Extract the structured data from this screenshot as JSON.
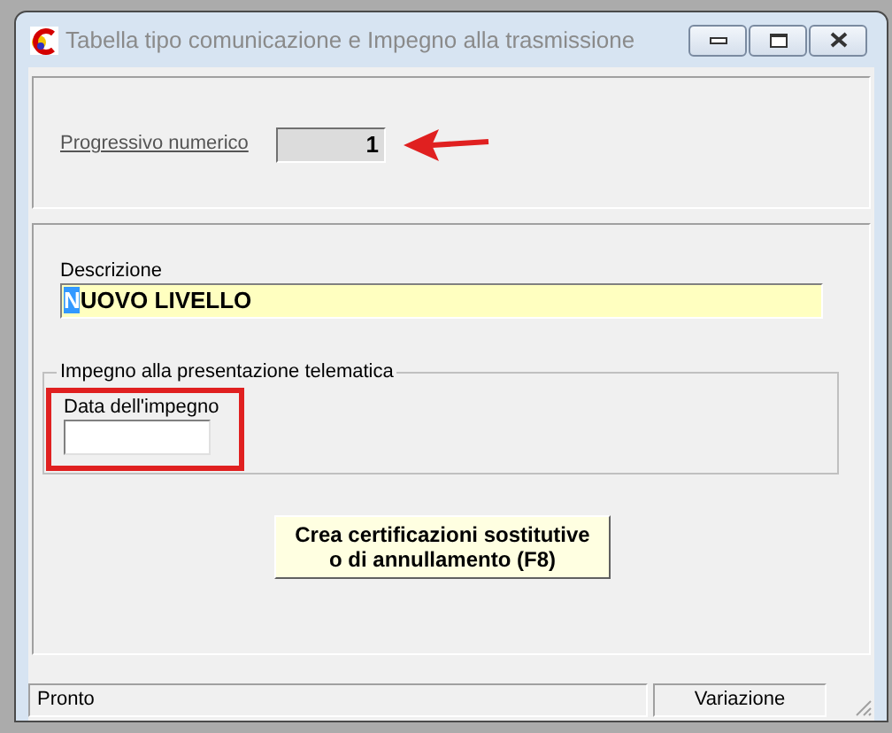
{
  "window": {
    "title": "Tabella tipo comunicazione e Impegno alla trasmissione"
  },
  "progressivo": {
    "label": "Progressivo numerico",
    "value": "1"
  },
  "descrizione": {
    "label": "Descrizione",
    "value": "NUOVO LIVELLO"
  },
  "impegno_group": {
    "title": "Impegno alla presentazione telematica",
    "data_label": "Data dell'impegno"
  },
  "action_button": {
    "label": "Crea certificazioni sostitutive o di annullamento (F8)"
  },
  "status_bar": [
    "Pronto",
    "Variazione"
  ]
}
